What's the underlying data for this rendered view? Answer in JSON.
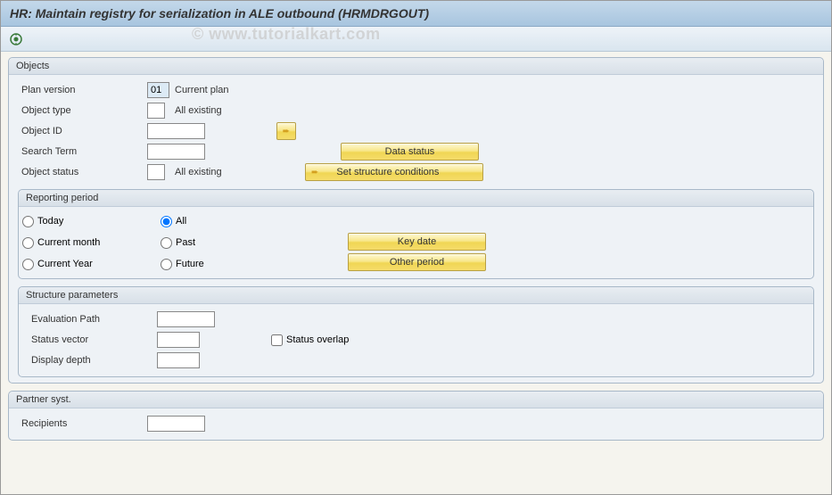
{
  "title": "HR: Maintain registry for serialization in ALE outbound (HRMDRGOUT)",
  "watermark": "© www.tutorialkart.com",
  "groups": {
    "objects": {
      "title": "Objects",
      "plan_version_label": "Plan version",
      "plan_version_value": "01",
      "plan_version_text": "Current plan",
      "object_type_label": "Object type",
      "object_type_value": "",
      "object_type_text": "All existing",
      "object_id_label": "Object ID",
      "object_id_value": "",
      "search_term_label": "Search Term",
      "search_term_value": "",
      "object_status_label": "Object status",
      "object_status_value": "",
      "object_status_text": "All existing",
      "btn_data_status": "Data status",
      "btn_structure": "Set structure conditions"
    },
    "reporting": {
      "title": "Reporting period",
      "today": "Today",
      "all": "All",
      "current_month": "Current month",
      "past": "Past",
      "current_year": "Current Year",
      "future": "Future",
      "btn_key_date": "Key date",
      "btn_other_period": "Other period",
      "selected": "all"
    },
    "structure": {
      "title": "Structure parameters",
      "eval_path_label": "Evaluation Path",
      "eval_path_value": "",
      "status_vector_label": "Status vector",
      "status_vector_value": "",
      "status_overlap_label": "Status overlap",
      "display_depth_label": "Display depth",
      "display_depth_value": ""
    },
    "partner": {
      "title": "Partner syst.",
      "recipients_label": "Recipients",
      "recipients_value": ""
    }
  }
}
